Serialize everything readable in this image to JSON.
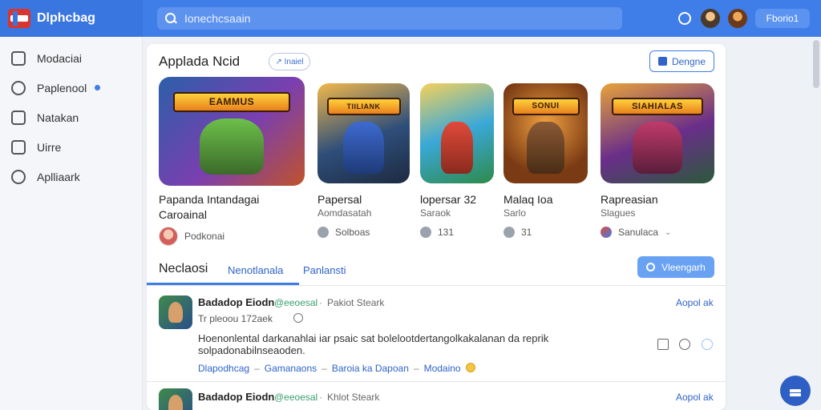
{
  "app": {
    "title": "Dlphcbag"
  },
  "search": {
    "value": "Ionechcsaain"
  },
  "topbar": {
    "button_label": "Fborio1"
  },
  "sidebar": {
    "items": [
      {
        "label": "Modaciai",
        "icon": "home-icon"
      },
      {
        "label": "Paplenool",
        "icon": "people-icon",
        "badge": true
      },
      {
        "label": "Natakan",
        "icon": "grid-icon"
      },
      {
        "label": "Uirre",
        "icon": "lock-icon"
      },
      {
        "label": "Aplliaark",
        "icon": "gear-icon"
      }
    ]
  },
  "section": {
    "title": "Applada Ncid",
    "chip_label": "↗ Inaiel",
    "action_label": "Dengne"
  },
  "games": [
    {
      "logo": "EAMMUS",
      "title": "Papanda Intandagai",
      "title2": "Caroainal",
      "subtitle": "",
      "meta": "Podkonai",
      "meta_icon": "avatar"
    },
    {
      "logo": "TIILIANK",
      "title": "Papersal",
      "subtitle": "Aomdasatah",
      "meta": "Solboas",
      "meta_icon": "comment-icon"
    },
    {
      "logo": "",
      "title": "lopersar 32",
      "subtitle": "Saraok",
      "meta": "131",
      "meta_icon": "clock-icon"
    },
    {
      "logo": "SONUI",
      "title": "Malaq Ioa",
      "subtitle": "Sarlo",
      "meta": "31",
      "meta_icon": "thumb-icon"
    },
    {
      "logo": "SIAHIALAS",
      "title": "Rapreasian",
      "subtitle": "Slagues",
      "meta": "Sanulaca",
      "meta_icon": "share-icon"
    }
  ],
  "tabs": [
    {
      "label": "Neclaosi"
    },
    {
      "label": "Nenotlanala"
    },
    {
      "label": "Panlansti"
    }
  ],
  "filter_button": {
    "label": "Vleengarh"
  },
  "posts": [
    {
      "name": "Badadop Eiodn",
      "handle": "@eeoesal",
      "extra": "Pakiot Steark",
      "link": "Aopol ak",
      "time": "Tr pleoou 172aek",
      "body": "Hoenonlental darkanahlai iar psaic sat  bolelootdertangolkakalanan da reprik solpadonabilnseaoden.",
      "tags": [
        "Dlapodhcag",
        "Gamanaons",
        "Baroia ka Dapoan",
        "Modaino"
      ]
    },
    {
      "name": "Badadop Eiodn",
      "handle": "@eeoesal",
      "extra": "Khlot Steark",
      "link": "Aopol ak"
    }
  ]
}
